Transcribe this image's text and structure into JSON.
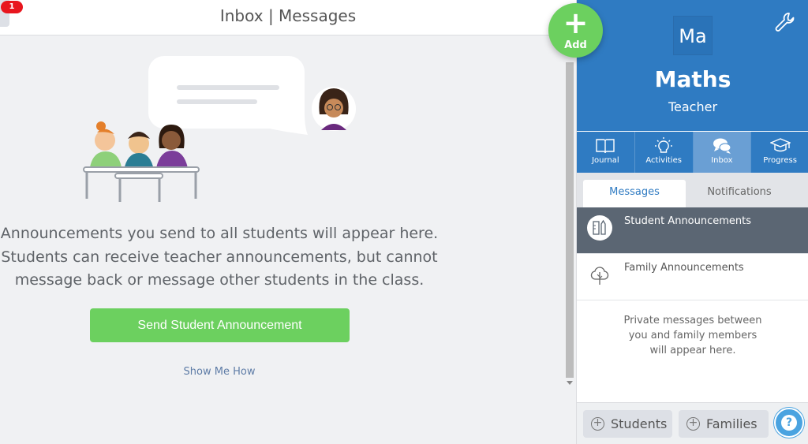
{
  "topbar": {
    "title": "Inbox | Messages",
    "notification_count": "1"
  },
  "main": {
    "empty_message_lines": [
      "Announcements you send to all students will appear here.",
      "Students can receive teacher announcements, but cannot",
      "message back or message other students in the class."
    ],
    "send_button_label": "Send Student Announcement",
    "show_me_how_label": "Show Me How"
  },
  "add_button": {
    "icon": "plus-icon",
    "label": "Add",
    "color": "#6cd05f"
  },
  "class": {
    "initials": "Ma",
    "name": "Maths",
    "role": "Teacher",
    "header_color": "#2f7bc2"
  },
  "nav": {
    "items": [
      {
        "label": "Journal",
        "icon": "book-icon",
        "active": false
      },
      {
        "label": "Activities",
        "icon": "lightbulb-icon",
        "active": false
      },
      {
        "label": "Inbox",
        "icon": "chat-bubbles-icon",
        "active": true
      },
      {
        "label": "Progress",
        "icon": "graduation-cap-icon",
        "active": false
      }
    ]
  },
  "tabs": {
    "messages": "Messages",
    "notifications": "Notifications",
    "active": "Messages"
  },
  "conversations": [
    {
      "label": "Student Announcements",
      "icon": "school-supplies-icon",
      "selected": true
    },
    {
      "label": "Family Announcements",
      "icon": "tree-icon",
      "selected": false
    }
  ],
  "private_note_lines": [
    "Private messages between",
    "you and family members",
    "will appear here."
  ],
  "bottom_bar": {
    "students_label": "Students",
    "families_label": "Families",
    "help_icon": "question-icon"
  }
}
